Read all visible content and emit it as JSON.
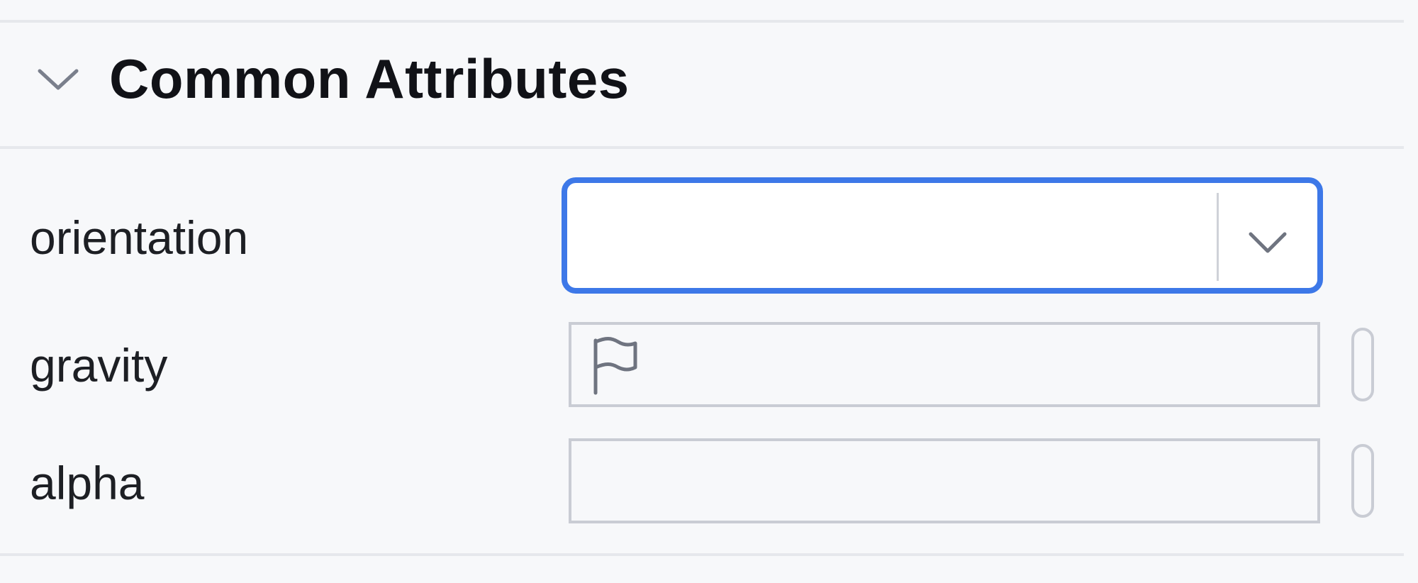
{
  "section": {
    "title": "Common Attributes",
    "collapse_icon": "chevron-down-icon"
  },
  "attributes": [
    {
      "label": "orientation",
      "control": "dropdown",
      "value": "",
      "icon": "chevron-down-icon"
    },
    {
      "label": "gravity",
      "control": "flag-field",
      "value": "",
      "icon": "flag-icon"
    },
    {
      "label": "alpha",
      "control": "text-field",
      "value": ""
    }
  ],
  "colors": {
    "focus_border": "#3d78e8",
    "field_border": "#c9ccd4",
    "background": "#f7f8fa"
  }
}
